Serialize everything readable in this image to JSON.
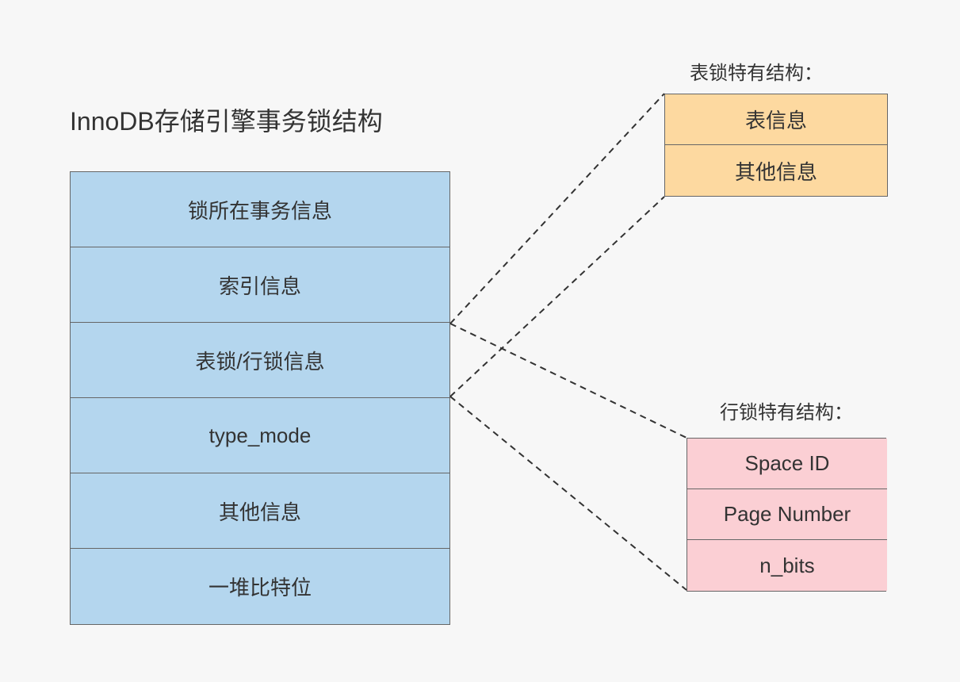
{
  "title": "InnoDB存储引擎事务锁结构",
  "main": {
    "rows": [
      "锁所在事务信息",
      "索引信息",
      "表锁/行锁信息",
      "type_mode",
      "其他信息",
      "一堆比特位"
    ]
  },
  "table_lock": {
    "title": "表锁特有结构：",
    "rows": [
      "表信息",
      "其他信息"
    ]
  },
  "row_lock": {
    "title": "行锁特有结构：",
    "rows": [
      "Space ID",
      "Page Number",
      "n_bits"
    ]
  }
}
